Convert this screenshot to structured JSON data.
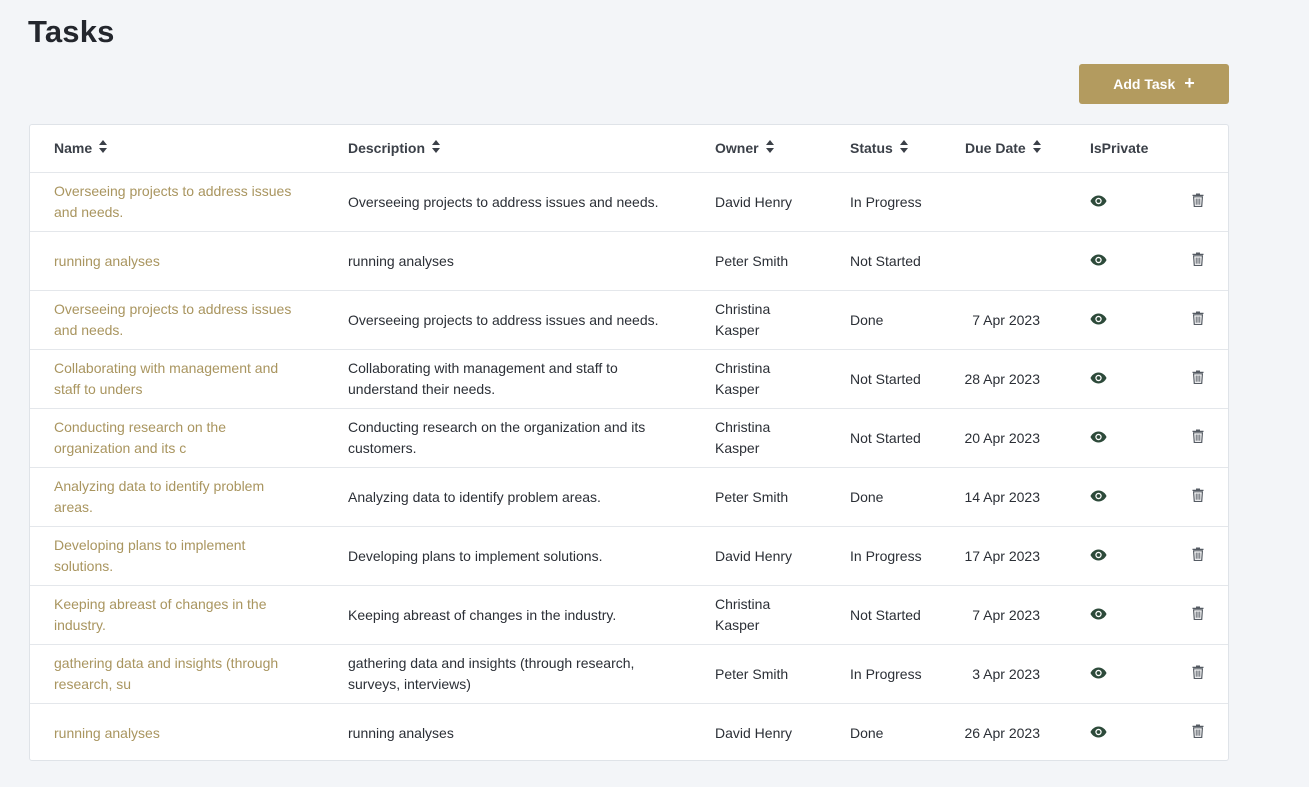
{
  "page": {
    "title": "Tasks"
  },
  "toolbar": {
    "add_task_label": "Add Task",
    "add_task_icon": "+"
  },
  "table": {
    "headers": {
      "name": "Name",
      "description": "Description",
      "owner": "Owner",
      "status": "Status",
      "due_date": "Due Date",
      "is_private": "IsPrivate"
    },
    "rows": [
      {
        "name": "Overseeing projects to address issues and needs.",
        "description": "Overseeing projects to address issues and needs.",
        "owner": "David Henry",
        "status": "In Progress",
        "due_date": ""
      },
      {
        "name": "running analyses",
        "description": "running analyses",
        "owner": "Peter Smith",
        "status": "Not Started",
        "due_date": ""
      },
      {
        "name": "Overseeing projects to address issues and needs.",
        "description": "Overseeing projects to address issues and needs.",
        "owner": "Christina Kasper",
        "status": "Done",
        "due_date": "7 Apr 2023"
      },
      {
        "name": "Collaborating with management and staff to unders",
        "description": "Collaborating with management and staff to understand their needs.",
        "owner": "Christina Kasper",
        "status": "Not Started",
        "due_date": "28 Apr 2023"
      },
      {
        "name": "Conducting research on the organization and its c",
        "description": "Conducting research on the organization and its customers.",
        "owner": "Christina Kasper",
        "status": "Not Started",
        "due_date": "20 Apr 2023"
      },
      {
        "name": "Analyzing data to identify problem areas.",
        "description": "Analyzing data to identify problem areas.",
        "owner": "Peter Smith",
        "status": "Done",
        "due_date": "14 Apr 2023"
      },
      {
        "name": "Developing plans to implement solutions.",
        "description": "Developing plans to implement solutions.",
        "owner": "David Henry",
        "status": "In Progress",
        "due_date": "17 Apr 2023"
      },
      {
        "name": "Keeping abreast of changes in the industry.",
        "description": "Keeping abreast of changes in the industry.",
        "owner": "Christina Kasper",
        "status": "Not Started",
        "due_date": "7 Apr 2023"
      },
      {
        "name": "gathering data and insights (through research, su",
        "description": "gathering data and insights (through research, surveys, interviews)",
        "owner": "Peter Smith",
        "status": "In Progress",
        "due_date": "3 Apr 2023"
      },
      {
        "name": "running analyses",
        "description": "running analyses",
        "owner": "David Henry",
        "status": "Done",
        "due_date": "26 Apr 2023"
      }
    ]
  },
  "icons": {
    "sort": "sort-icon",
    "visibility": "eye-icon",
    "delete": "trash-icon",
    "add": "plus-icon"
  },
  "colors": {
    "accent": "#b39b5f",
    "link": "#a9955f",
    "eye_icon": "#2d4a3a",
    "background": "#f3f5f8"
  }
}
